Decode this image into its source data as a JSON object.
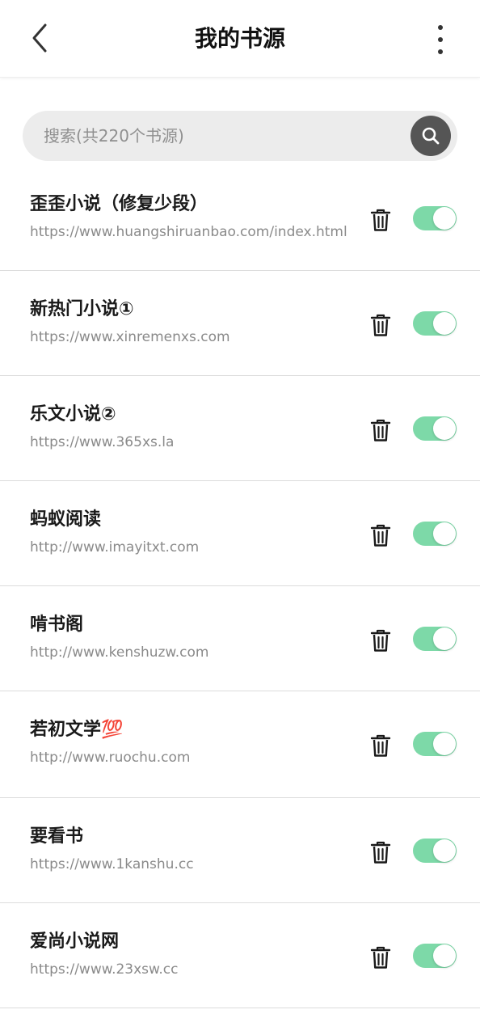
{
  "header": {
    "title": "我的书源"
  },
  "search": {
    "placeholder": "搜索(共220个书源)"
  },
  "sources": [
    {
      "name": "歪歪小说（修复少段）",
      "url": "https://www.huangshiruanbao.com/index.html",
      "enabled": true
    },
    {
      "name": "新热门小说①",
      "url": "https://www.xinremenxs.com",
      "enabled": true
    },
    {
      "name": "乐文小说②",
      "url": "https://www.365xs.la",
      "enabled": true
    },
    {
      "name": "蚂蚁阅读",
      "url": "http://www.imayitxt.com",
      "enabled": true
    },
    {
      "name": "啃书阁",
      "url": "http://www.kenshuzw.com",
      "enabled": true
    },
    {
      "name": "若初文学💯",
      "url": "http://www.ruochu.com",
      "enabled": true
    },
    {
      "name": "要看书",
      "url": "https://www.1kanshu.cc",
      "enabled": true
    },
    {
      "name": "爱尚小说网",
      "url": "https://www.23xsw.cc",
      "enabled": true
    }
  ],
  "colors": {
    "toggle_on": "#7dd9a8",
    "search_button": "#555555"
  }
}
